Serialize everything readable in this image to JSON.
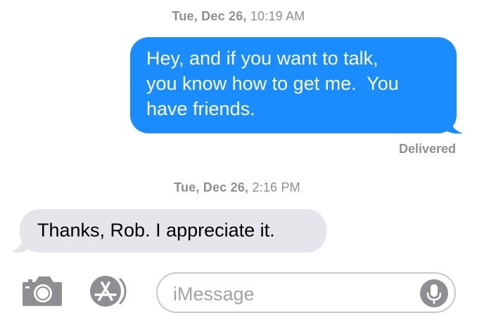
{
  "conversation": {
    "messages": [
      {
        "timestamp_day": "Tue, Dec 26,",
        "timestamp_time": "10:19 AM",
        "direction": "outgoing",
        "lines": [
          "Hey, and if you want to talk,",
          "you know how to get me.  You",
          "have friends."
        ],
        "status": "Delivered"
      },
      {
        "timestamp_day": "Tue, Dec 26,",
        "timestamp_time": "2:16 PM",
        "direction": "incoming",
        "lines": [
          "Thanks, Rob. I appreciate it."
        ]
      }
    ]
  },
  "composer": {
    "placeholder": "iMessage",
    "camera_icon": "camera-icon",
    "apps_icon": "app-store-icon",
    "mic_icon": "microphone-icon"
  },
  "colors": {
    "outgoing_bubble": "#1a8cfb",
    "incoming_bubble": "#e6e5eb",
    "meta_text": "#8e8e93",
    "icon_gray": "#8e8e93"
  }
}
